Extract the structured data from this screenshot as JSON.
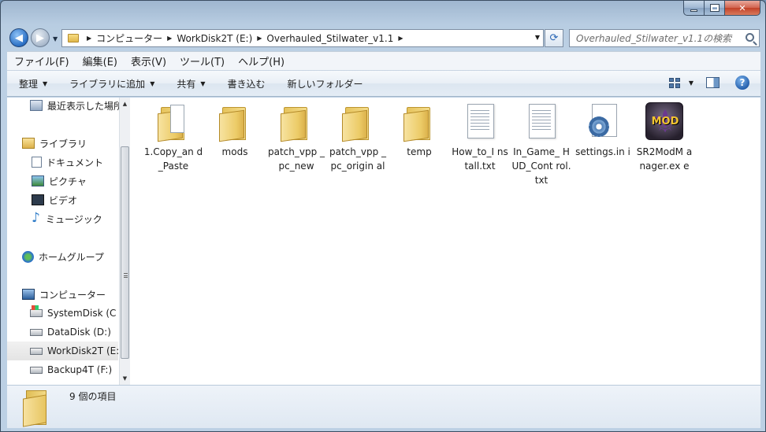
{
  "window": {
    "caption_buttons": [
      "minimize",
      "maximize",
      "close"
    ]
  },
  "address": {
    "crumbs": [
      "コンピューター",
      "WorkDisk2T (E:)",
      "Overhauled_Stilwater_v1.1"
    ]
  },
  "search": {
    "placeholder": "Overhauled_Stilwater_v1.1の検索"
  },
  "menu": [
    "ファイル(F)",
    "編集(E)",
    "表示(V)",
    "ツール(T)",
    "ヘルプ(H)"
  ],
  "commands": {
    "organize": "整理",
    "add_to_library": "ライブラリに追加",
    "share": "共有",
    "burn": "書き込む",
    "new_folder": "新しいフォルダー"
  },
  "nav": {
    "recent": "最近表示した場所",
    "libraries": "ライブラリ",
    "documents": "ドキュメント",
    "pictures": "ピクチャ",
    "videos": "ビデオ",
    "music": "ミュージック",
    "homegroup": "ホームグループ",
    "computer": "コンピューター",
    "drives": [
      {
        "label": "SystemDisk (C",
        "icon": "system-disk-icon"
      },
      {
        "label": "DataDisk (D:)",
        "icon": "drive-icon"
      },
      {
        "label": "WorkDisk2T (E:",
        "icon": "drive-icon",
        "selected": true
      },
      {
        "label": "Backup4T (F:)",
        "icon": "drive-icon"
      }
    ]
  },
  "files": [
    {
      "name": "1.Copy_an d_Paste",
      "icon": "folder-with-documents-icon"
    },
    {
      "name": "mods",
      "icon": "folder-icon"
    },
    {
      "name": "patch_vpp _pc_new",
      "icon": "folder-icon"
    },
    {
      "name": "patch_vpp _pc_origin al",
      "icon": "folder-icon"
    },
    {
      "name": "temp",
      "icon": "folder-icon"
    },
    {
      "name": "How_to_I nstall.txt",
      "icon": "text-file-icon"
    },
    {
      "name": "In_Game_ HUD_Cont rol.txt",
      "icon": "text-file-icon"
    },
    {
      "name": "settings.in i",
      "icon": "settings-file-icon"
    },
    {
      "name": "SR2ModM anager.ex e",
      "icon": "mod-manager-exe-icon",
      "icon_text": "MOD"
    }
  ],
  "details": {
    "count": "9 個の項目"
  }
}
